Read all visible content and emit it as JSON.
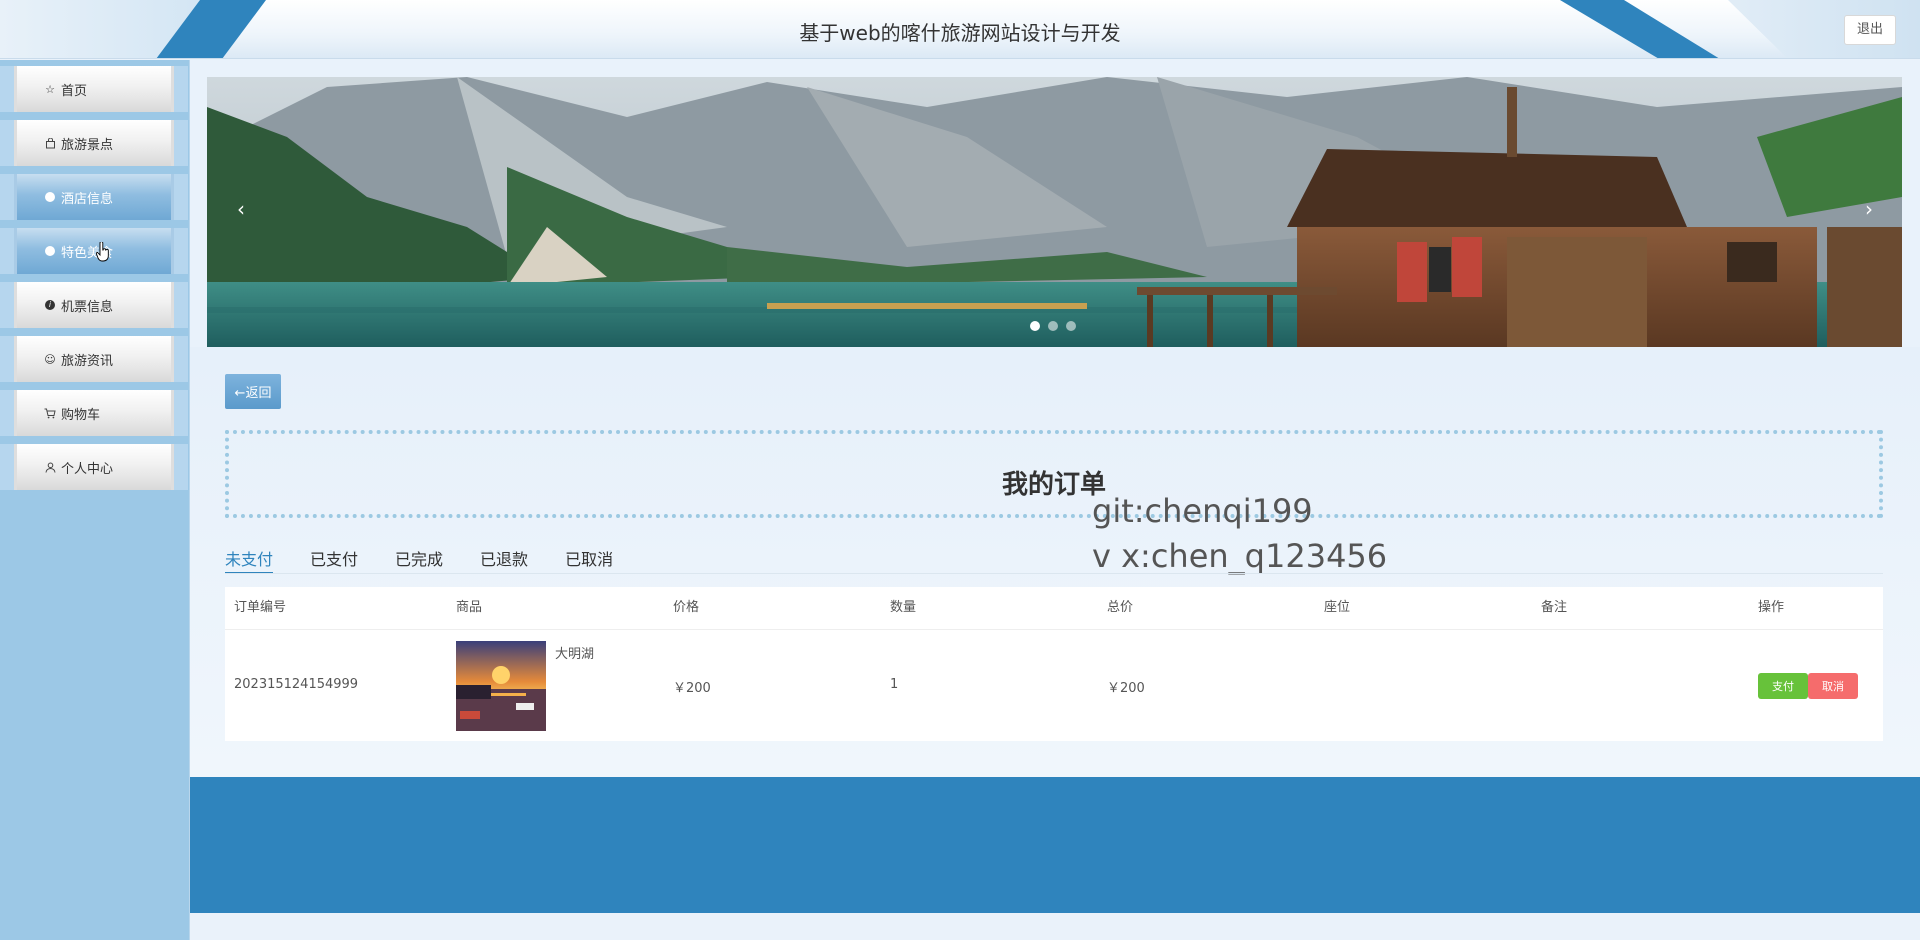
{
  "header": {
    "title": "基于web的喀什旅游网站设计与开发",
    "logout_label": "退出"
  },
  "sidebar": {
    "items": [
      {
        "label": "首页",
        "icon": "star-icon"
      },
      {
        "label": "旅游景点",
        "icon": "bag-icon"
      },
      {
        "label": "酒店信息",
        "icon": "circle-icon",
        "active": true
      },
      {
        "label": "特色美食",
        "icon": "circle-icon",
        "active": true
      },
      {
        "label": "机票信息",
        "icon": "info-icon"
      },
      {
        "label": "旅游资讯",
        "icon": "smile-icon"
      },
      {
        "label": "购物车",
        "icon": "cart-icon"
      },
      {
        "label": "个人中心",
        "icon": "user-icon"
      }
    ]
  },
  "banner": {
    "prev": "‹",
    "next": "›",
    "slide_count": 3,
    "active_slide": 1
  },
  "back_label": "←返回",
  "page_title": "我的订单",
  "watermark": {
    "line1": "git:chenqi199",
    "line2": "v x:chen_q123456"
  },
  "tabs": [
    "未支付",
    "已支付",
    "已完成",
    "已退款",
    "已取消"
  ],
  "table": {
    "columns": [
      "订单编号",
      "商品",
      "价格",
      "数量",
      "总价",
      "座位",
      "备注",
      "操作"
    ],
    "rows": [
      {
        "order_no": "202315124154999",
        "product": "大明湖",
        "price": "￥200",
        "quantity": "1",
        "total": "￥200",
        "seat": "",
        "remark": "",
        "pay_label": "支付",
        "cancel_label": "取消"
      }
    ]
  },
  "colors": {
    "primary": "#2f84bd",
    "pay": "#67c23a",
    "cancel": "#f56c6c"
  }
}
